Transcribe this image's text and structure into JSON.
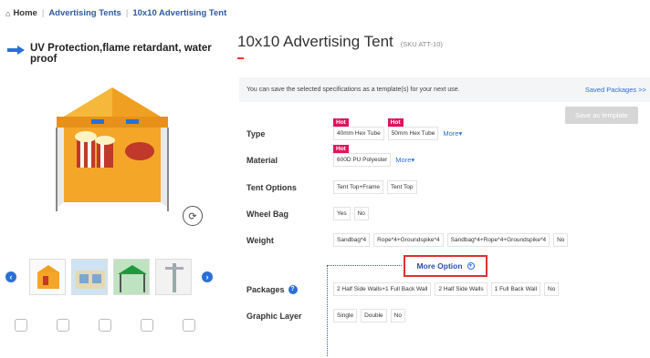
{
  "breadcrumb": {
    "home": "Home",
    "items": [
      "Advertising Tents",
      "10x10 Advertising Tent"
    ]
  },
  "product": {
    "feature_text": "UV Protection,flame retardant, water proof",
    "title": "10x10 Advertising Tent",
    "sku": "(SKU ATT-10)"
  },
  "template": {
    "note": "You can save the selected specifications as a template(s) for your next use.",
    "saved_link": "Saved Packages >>",
    "save_button": "Save as template"
  },
  "specs": {
    "type": {
      "label": "Type",
      "options": [
        {
          "text": "40mm Hex Tube",
          "hot": "Hot"
        },
        {
          "text": "50mm Hex Tube",
          "hot": "Hot"
        }
      ],
      "more": "More▾"
    },
    "material": {
      "label": "Material",
      "options": [
        {
          "text": "600D PU Polyester",
          "hot": "Hot"
        }
      ],
      "more": "More▾"
    },
    "tent_options": {
      "label": "Tent Options",
      "options": [
        "Tent Top+Frame",
        "Tent Top"
      ]
    },
    "wheel_bag": {
      "label": "Wheel Bag",
      "options": [
        "Yes",
        "No"
      ]
    },
    "weight": {
      "label": "Weight",
      "options": [
        "Sandbag*4",
        "Rope*4+Groundspike*4",
        "Sandbag*4+Rope*4+Groundspike*4",
        "No"
      ]
    },
    "packages": {
      "label": "Packages",
      "help": "?",
      "options": [
        "2 Half Side Walls+1 Full Back Wall",
        "2 Half Side Walls",
        "1 Full Back Wall",
        "No"
      ]
    },
    "graphic_layer": {
      "label": "Graphic Layer",
      "options": [
        "Single",
        "Double",
        "No"
      ]
    }
  },
  "more_option": "More Option",
  "colors": {
    "accent_blue": "#2a6fd6",
    "hot_badge": "#e0145b",
    "highlight_red": "#e03030",
    "tent_orange": "#f0a020"
  }
}
